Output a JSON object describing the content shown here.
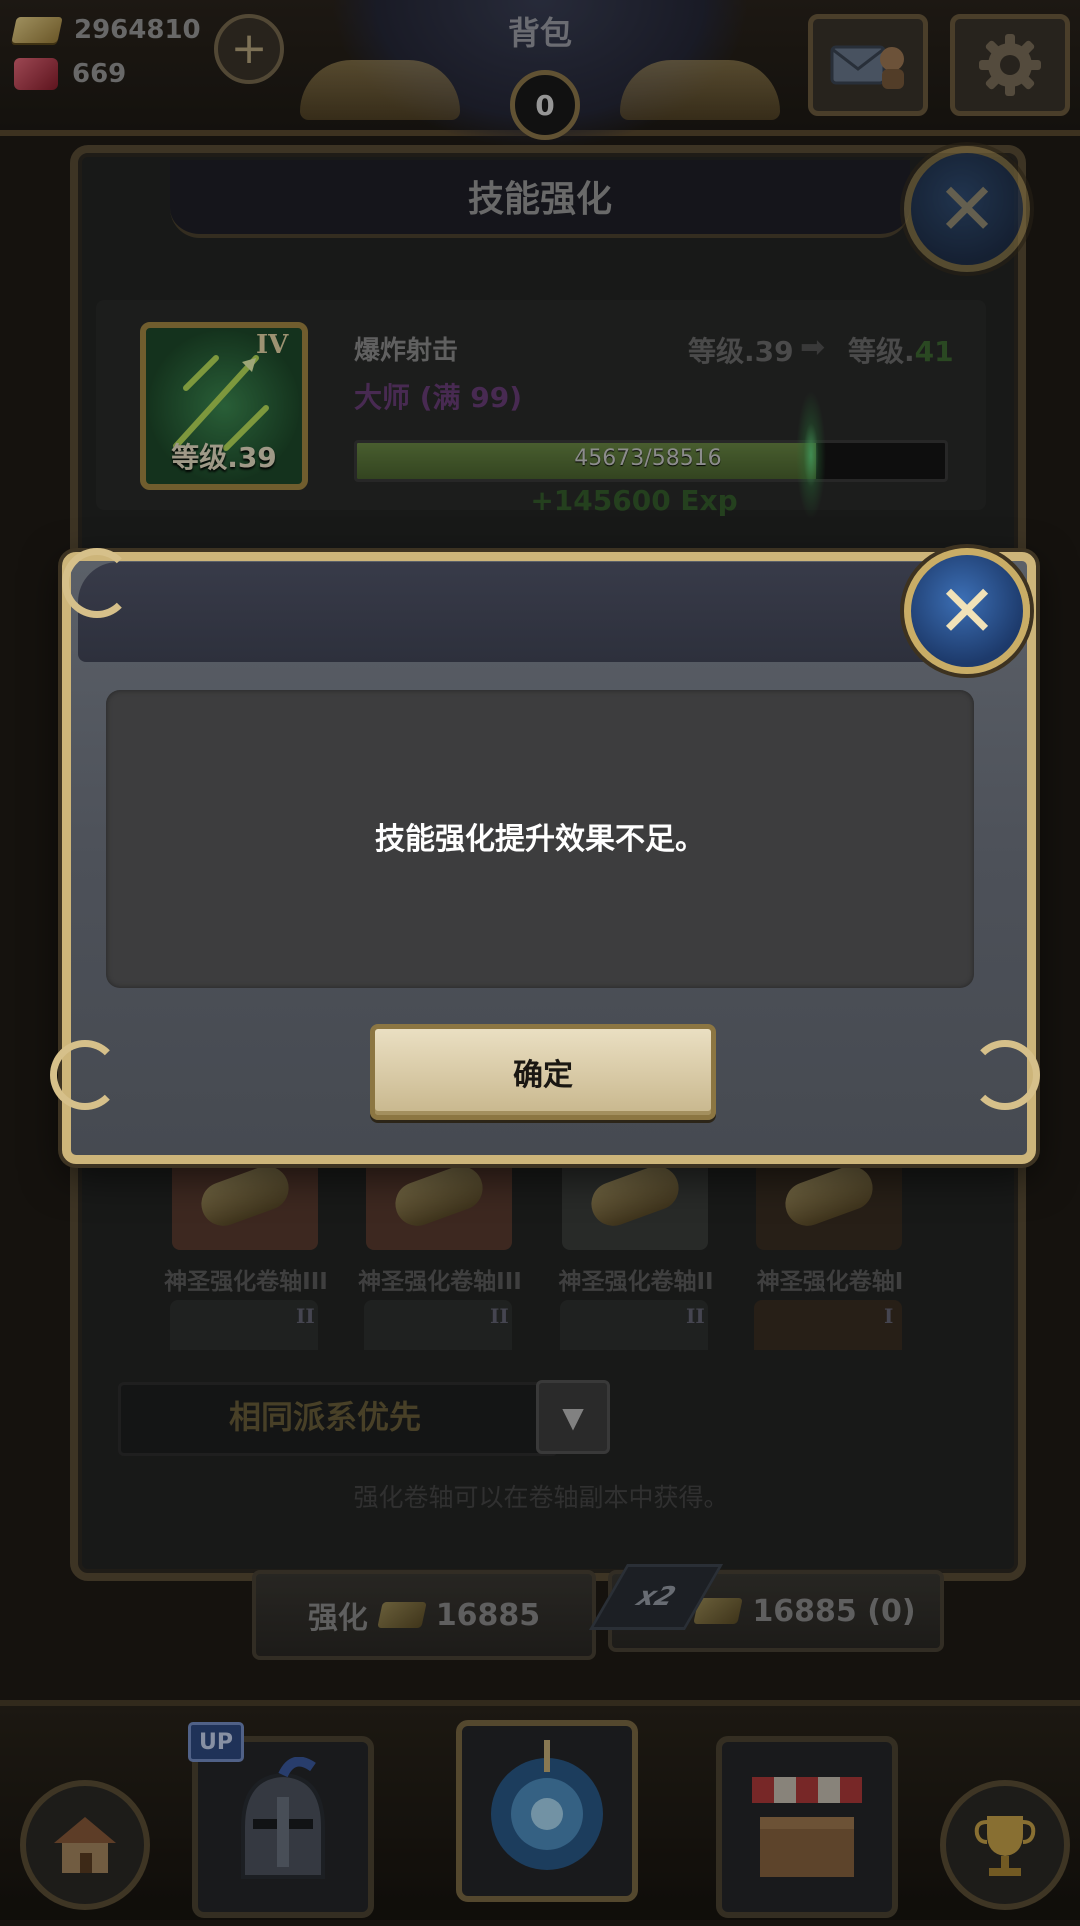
{
  "top_bar": {
    "gold_amount": "2964810",
    "gem_amount": "669",
    "add_label": "+",
    "bag_title": "背包",
    "bag_count": "0",
    "icons": [
      "gold-bar-icon",
      "gem-icon",
      "mail-icon",
      "settings-gear-icon"
    ]
  },
  "skill_panel": {
    "title": "技能强化",
    "skill": {
      "tier": "IV",
      "icon_level": "等级.39",
      "name": "爆炸射击",
      "rank": "大师 (满 99)",
      "level_from": "等级.39",
      "level_arrow": "➡",
      "level_to_prefix": "等级.",
      "level_to_value": "41",
      "exp_text": "45673/58516",
      "exp_progress": 0.78,
      "exp_gain": "+145600 Exp"
    },
    "scrolls": [
      {
        "label": "神圣强化卷轴III",
        "tier_below": "II",
        "bg": "#5a3c30"
      },
      {
        "label": "神圣强化卷轴III",
        "tier_below": "II",
        "bg": "#5a3c30"
      },
      {
        "label": "神圣强化卷轴II",
        "tier_below": "II",
        "bg": "#3b3e3c"
      },
      {
        "label": "神圣强化卷轴I",
        "tier_below": "I",
        "bg": "#3a2e22"
      }
    ],
    "sort": {
      "selected": "相同派系优先",
      "arrow": "▼"
    },
    "hint": "强化卷轴可以在卷轴副本中获得。",
    "enhance_button": {
      "label": "强化",
      "cost": "16885"
    },
    "double_button": {
      "tag": "x2",
      "cost": "16885 (0)"
    }
  },
  "bottom_nav": {
    "up_badge": "UP",
    "items": [
      "home-icon",
      "knight-helmet-icon",
      "portal-icon",
      "shop-icon",
      "trophy-icon"
    ]
  },
  "dialog": {
    "message": "技能强化提升效果不足。",
    "confirm_label": "确定",
    "close_label": "✕"
  },
  "colors": {
    "dialog_border": "#cdb57a",
    "close_button_blue": "#3c6fb5",
    "confirm_button": "#eadfc2"
  }
}
